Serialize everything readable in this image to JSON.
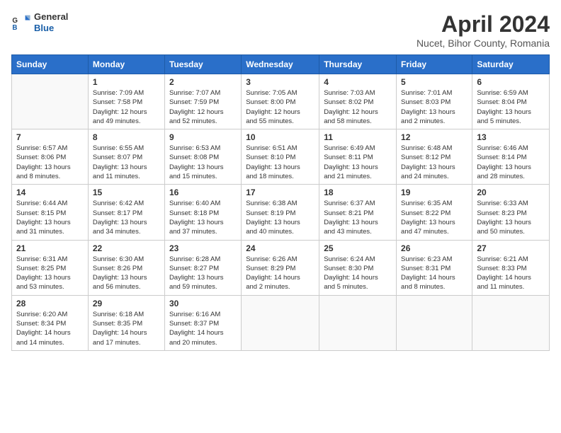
{
  "logo": {
    "general": "General",
    "blue": "Blue"
  },
  "title": "April 2024",
  "location": "Nucet, Bihor County, Romania",
  "days_of_week": [
    "Sunday",
    "Monday",
    "Tuesday",
    "Wednesday",
    "Thursday",
    "Friday",
    "Saturday"
  ],
  "weeks": [
    [
      {
        "day": "",
        "sunrise": "",
        "sunset": "",
        "daylight": ""
      },
      {
        "day": "1",
        "sunrise": "Sunrise: 7:09 AM",
        "sunset": "Sunset: 7:58 PM",
        "daylight": "Daylight: 12 hours and 49 minutes."
      },
      {
        "day": "2",
        "sunrise": "Sunrise: 7:07 AM",
        "sunset": "Sunset: 7:59 PM",
        "daylight": "Daylight: 12 hours and 52 minutes."
      },
      {
        "day": "3",
        "sunrise": "Sunrise: 7:05 AM",
        "sunset": "Sunset: 8:00 PM",
        "daylight": "Daylight: 12 hours and 55 minutes."
      },
      {
        "day": "4",
        "sunrise": "Sunrise: 7:03 AM",
        "sunset": "Sunset: 8:02 PM",
        "daylight": "Daylight: 12 hours and 58 minutes."
      },
      {
        "day": "5",
        "sunrise": "Sunrise: 7:01 AM",
        "sunset": "Sunset: 8:03 PM",
        "daylight": "Daylight: 13 hours and 2 minutes."
      },
      {
        "day": "6",
        "sunrise": "Sunrise: 6:59 AM",
        "sunset": "Sunset: 8:04 PM",
        "daylight": "Daylight: 13 hours and 5 minutes."
      }
    ],
    [
      {
        "day": "7",
        "sunrise": "Sunrise: 6:57 AM",
        "sunset": "Sunset: 8:06 PM",
        "daylight": "Daylight: 13 hours and 8 minutes."
      },
      {
        "day": "8",
        "sunrise": "Sunrise: 6:55 AM",
        "sunset": "Sunset: 8:07 PM",
        "daylight": "Daylight: 13 hours and 11 minutes."
      },
      {
        "day": "9",
        "sunrise": "Sunrise: 6:53 AM",
        "sunset": "Sunset: 8:08 PM",
        "daylight": "Daylight: 13 hours and 15 minutes."
      },
      {
        "day": "10",
        "sunrise": "Sunrise: 6:51 AM",
        "sunset": "Sunset: 8:10 PM",
        "daylight": "Daylight: 13 hours and 18 minutes."
      },
      {
        "day": "11",
        "sunrise": "Sunrise: 6:49 AM",
        "sunset": "Sunset: 8:11 PM",
        "daylight": "Daylight: 13 hours and 21 minutes."
      },
      {
        "day": "12",
        "sunrise": "Sunrise: 6:48 AM",
        "sunset": "Sunset: 8:12 PM",
        "daylight": "Daylight: 13 hours and 24 minutes."
      },
      {
        "day": "13",
        "sunrise": "Sunrise: 6:46 AM",
        "sunset": "Sunset: 8:14 PM",
        "daylight": "Daylight: 13 hours and 28 minutes."
      }
    ],
    [
      {
        "day": "14",
        "sunrise": "Sunrise: 6:44 AM",
        "sunset": "Sunset: 8:15 PM",
        "daylight": "Daylight: 13 hours and 31 minutes."
      },
      {
        "day": "15",
        "sunrise": "Sunrise: 6:42 AM",
        "sunset": "Sunset: 8:17 PM",
        "daylight": "Daylight: 13 hours and 34 minutes."
      },
      {
        "day": "16",
        "sunrise": "Sunrise: 6:40 AM",
        "sunset": "Sunset: 8:18 PM",
        "daylight": "Daylight: 13 hours and 37 minutes."
      },
      {
        "day": "17",
        "sunrise": "Sunrise: 6:38 AM",
        "sunset": "Sunset: 8:19 PM",
        "daylight": "Daylight: 13 hours and 40 minutes."
      },
      {
        "day": "18",
        "sunrise": "Sunrise: 6:37 AM",
        "sunset": "Sunset: 8:21 PM",
        "daylight": "Daylight: 13 hours and 43 minutes."
      },
      {
        "day": "19",
        "sunrise": "Sunrise: 6:35 AM",
        "sunset": "Sunset: 8:22 PM",
        "daylight": "Daylight: 13 hours and 47 minutes."
      },
      {
        "day": "20",
        "sunrise": "Sunrise: 6:33 AM",
        "sunset": "Sunset: 8:23 PM",
        "daylight": "Daylight: 13 hours and 50 minutes."
      }
    ],
    [
      {
        "day": "21",
        "sunrise": "Sunrise: 6:31 AM",
        "sunset": "Sunset: 8:25 PM",
        "daylight": "Daylight: 13 hours and 53 minutes."
      },
      {
        "day": "22",
        "sunrise": "Sunrise: 6:30 AM",
        "sunset": "Sunset: 8:26 PM",
        "daylight": "Daylight: 13 hours and 56 minutes."
      },
      {
        "day": "23",
        "sunrise": "Sunrise: 6:28 AM",
        "sunset": "Sunset: 8:27 PM",
        "daylight": "Daylight: 13 hours and 59 minutes."
      },
      {
        "day": "24",
        "sunrise": "Sunrise: 6:26 AM",
        "sunset": "Sunset: 8:29 PM",
        "daylight": "Daylight: 14 hours and 2 minutes."
      },
      {
        "day": "25",
        "sunrise": "Sunrise: 6:24 AM",
        "sunset": "Sunset: 8:30 PM",
        "daylight": "Daylight: 14 hours and 5 minutes."
      },
      {
        "day": "26",
        "sunrise": "Sunrise: 6:23 AM",
        "sunset": "Sunset: 8:31 PM",
        "daylight": "Daylight: 14 hours and 8 minutes."
      },
      {
        "day": "27",
        "sunrise": "Sunrise: 6:21 AM",
        "sunset": "Sunset: 8:33 PM",
        "daylight": "Daylight: 14 hours and 11 minutes."
      }
    ],
    [
      {
        "day": "28",
        "sunrise": "Sunrise: 6:20 AM",
        "sunset": "Sunset: 8:34 PM",
        "daylight": "Daylight: 14 hours and 14 minutes."
      },
      {
        "day": "29",
        "sunrise": "Sunrise: 6:18 AM",
        "sunset": "Sunset: 8:35 PM",
        "daylight": "Daylight: 14 hours and 17 minutes."
      },
      {
        "day": "30",
        "sunrise": "Sunrise: 6:16 AM",
        "sunset": "Sunset: 8:37 PM",
        "daylight": "Daylight: 14 hours and 20 minutes."
      },
      {
        "day": "",
        "sunrise": "",
        "sunset": "",
        "daylight": ""
      },
      {
        "day": "",
        "sunrise": "",
        "sunset": "",
        "daylight": ""
      },
      {
        "day": "",
        "sunrise": "",
        "sunset": "",
        "daylight": ""
      },
      {
        "day": "",
        "sunrise": "",
        "sunset": "",
        "daylight": ""
      }
    ]
  ]
}
